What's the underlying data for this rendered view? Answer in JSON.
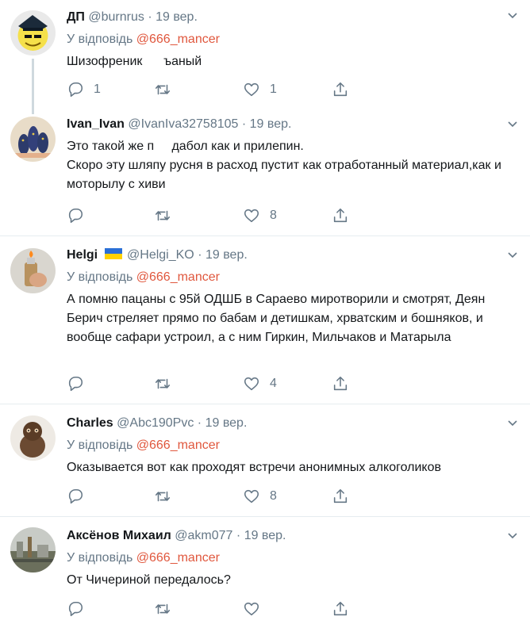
{
  "tweets": [
    {
      "name": "ДП",
      "handle": "@burnrus",
      "separator": "·",
      "date": "19 вер.",
      "replying_prefix": "У відповідь",
      "replying_to": "@666_mancer",
      "text": "Шизофреник      ъаный",
      "counts": {
        "reply": "1",
        "retweet": "",
        "like": "1",
        "share": ""
      }
    },
    {
      "name": "Ivan_Ivan",
      "handle": "@IvanIva32758105",
      "separator": "·",
      "date": "19 вер.",
      "text": "Это такой же п     дабол как и прилепин.\nСкоро эту шляпу русня в расход пустит как отработанный материал,как и моторылу с хиви",
      "counts": {
        "reply": "",
        "retweet": "",
        "like": "8",
        "share": ""
      }
    },
    {
      "name": "Helgi",
      "handle": "@Helgi_KO",
      "separator": "·",
      "date": "19 вер.",
      "replying_prefix": "У відповідь",
      "replying_to": "@666_mancer",
      "text": "А помню пацаны с 95й ОДШБ в Сараево миротворили и смотрят, Деян Берич стреляет прямо по бабам и детишкам, хрватским и бошняков, и вообще сафари устроил, а с ним Гиркин, Мильчаков и Матарыла",
      "counts": {
        "reply": "",
        "retweet": "",
        "like": "4",
        "share": ""
      }
    },
    {
      "name": "Charles",
      "handle": "@Abc190Pvc",
      "separator": "·",
      "date": "19 вер.",
      "replying_prefix": "У відповідь",
      "replying_to": "@666_mancer",
      "text": "Оказывается вот как проходят встречи анонимных алкоголиков",
      "counts": {
        "reply": "",
        "retweet": "",
        "like": "8",
        "share": ""
      }
    },
    {
      "name": "Аксёнов Михаил",
      "handle": "@akm077",
      "separator": "·",
      "date": "19 вер.",
      "replying_prefix": "У відповідь",
      "replying_to": "@666_mancer",
      "text": "От Чичериной передалось?",
      "counts": {
        "reply": "",
        "retweet": "",
        "like": "",
        "share": ""
      }
    }
  ],
  "colors": {
    "mention": "#e0573d",
    "secondary": "#657786",
    "border": "#e6ecf0"
  },
  "icons": [
    "reply-icon",
    "retweet-icon",
    "like-icon",
    "share-icon",
    "caret-down-icon",
    "ukraine-flag-icon"
  ]
}
